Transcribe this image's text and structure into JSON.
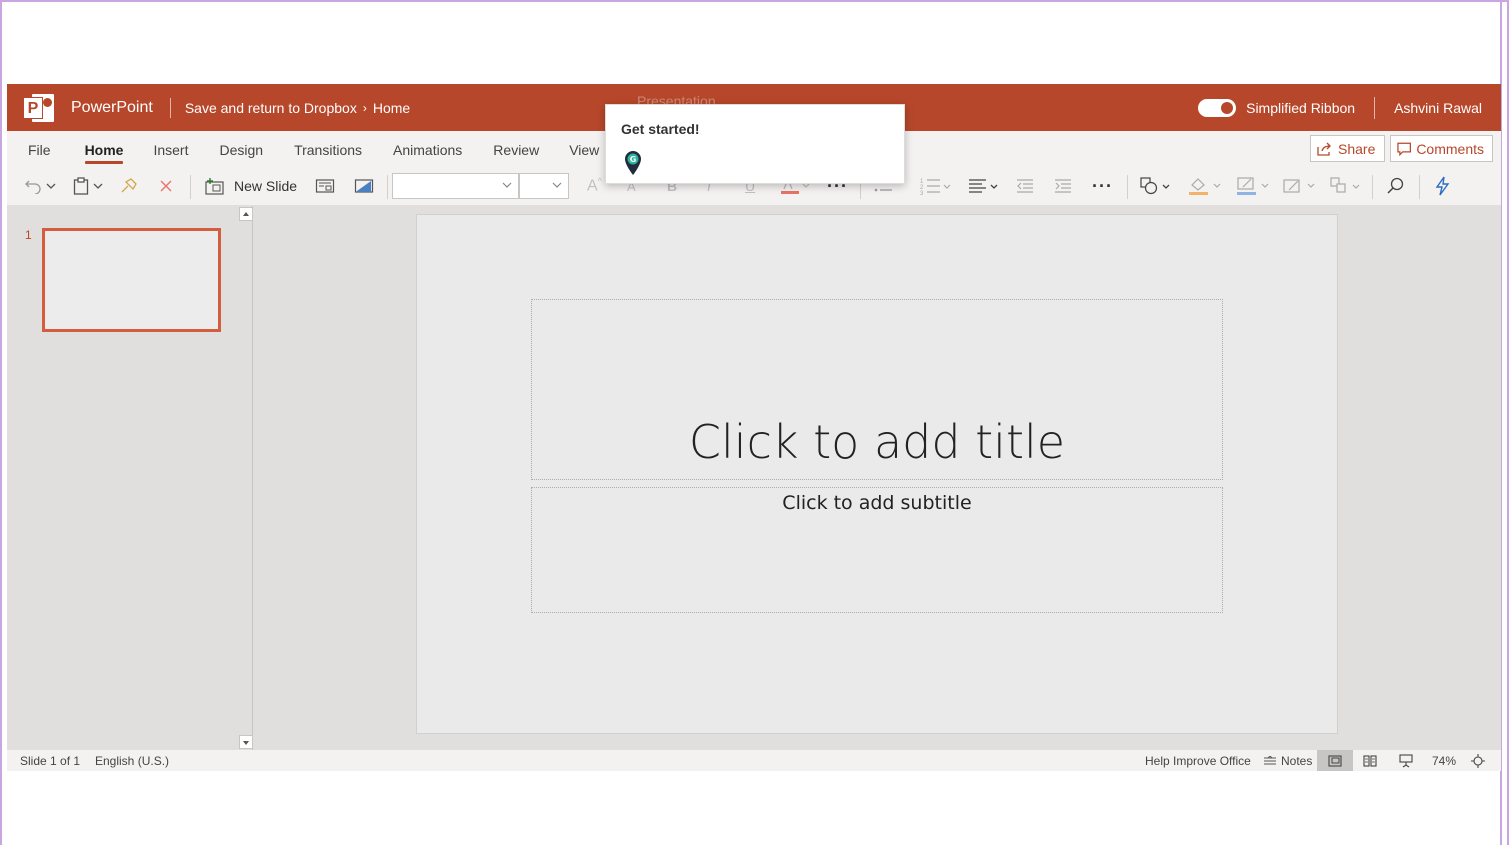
{
  "titlebar": {
    "app_name": "PowerPoint",
    "breadcrumb_parent": "Save and return to Dropbox",
    "breadcrumb_current": "Home",
    "doc_title_hidden": "Presentation",
    "simplified_ribbon_label": "Simplified Ribbon",
    "user_name": "Ashvini Rawal"
  },
  "tabs": [
    {
      "label": "File"
    },
    {
      "label": "Home"
    },
    {
      "label": "Insert"
    },
    {
      "label": "Design"
    },
    {
      "label": "Transitions"
    },
    {
      "label": "Animations"
    },
    {
      "label": "Review"
    },
    {
      "label": "View"
    }
  ],
  "ribbon_actions": {
    "share_label": "Share",
    "comments_label": "Comments"
  },
  "toolbar": {
    "new_slide_label": "New Slide",
    "font_name": "",
    "font_size": ""
  },
  "popup": {
    "title": "Get started!"
  },
  "thumbnails": [
    {
      "number": "1"
    }
  ],
  "slide": {
    "title_placeholder": "Click to add title",
    "subtitle_placeholder": "Click to add subtitle"
  },
  "statusbar": {
    "slide_info": "Slide 1 of 1",
    "language": "English (U.S.)",
    "help_improve": "Help Improve Office",
    "notes_label": "Notes",
    "zoom": "74%"
  },
  "colors": {
    "brand": "#b7472a",
    "thumb_border": "#d35d3e"
  }
}
